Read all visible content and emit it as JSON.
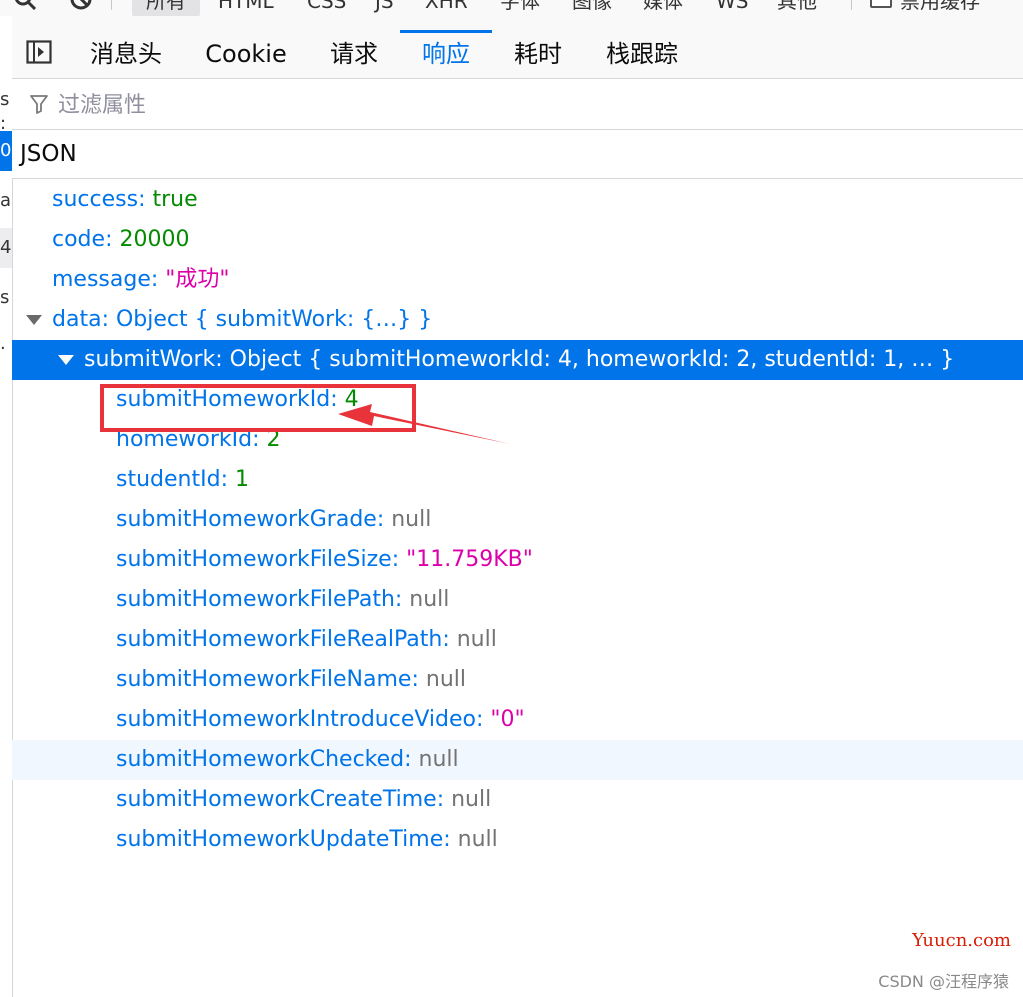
{
  "top_toolbar": {
    "filters": [
      "所有",
      "HTML",
      "CSS",
      "JS",
      "XHR",
      "字体",
      "图像",
      "媒体",
      "WS",
      "其他"
    ],
    "active_filter": "所有",
    "disable_cache_label": "禁用缓存"
  },
  "left_strip": [
    "s",
    ":",
    "0",
    "a",
    "4",
    "s",
    "."
  ],
  "tabs": [
    "消息头",
    "Cookie",
    "请求",
    "响应",
    "耗时",
    "栈跟踪"
  ],
  "active_tab": "响应",
  "filter": {
    "placeholder": "过滤属性"
  },
  "section_title": "JSON",
  "tree": {
    "success": {
      "key": "success",
      "value": "true"
    },
    "code": {
      "key": "code",
      "value": "20000"
    },
    "message": {
      "key": "message",
      "value": "\"成功\""
    },
    "data": {
      "key": "data",
      "value": "Object { submitWork: {…} }"
    },
    "submitWork": {
      "key": "submitWork",
      "value": "Object { submitHomeworkId: 4, homeworkId: 2, studentId: 1, … }"
    },
    "fields": [
      {
        "key": "submitHomeworkId",
        "value": "4",
        "type": "num"
      },
      {
        "key": "homeworkId",
        "value": "2",
        "type": "num"
      },
      {
        "key": "studentId",
        "value": "1",
        "type": "num"
      },
      {
        "key": "submitHomeworkGrade",
        "value": "null",
        "type": "null"
      },
      {
        "key": "submitHomeworkFileSize",
        "value": "\"11.759KB\"",
        "type": "str"
      },
      {
        "key": "submitHomeworkFilePath",
        "value": "null",
        "type": "null"
      },
      {
        "key": "submitHomeworkFileRealPath",
        "value": "null",
        "type": "null"
      },
      {
        "key": "submitHomeworkFileName",
        "value": "null",
        "type": "null"
      },
      {
        "key": "submitHomeworkIntroduceVideo",
        "value": "\"0\"",
        "type": "str"
      },
      {
        "key": "submitHomeworkChecked",
        "value": "null",
        "type": "null"
      },
      {
        "key": "submitHomeworkCreateTime",
        "value": "null",
        "type": "null"
      },
      {
        "key": "submitHomeworkUpdateTime",
        "value": "null",
        "type": "null"
      }
    ]
  },
  "watermark": {
    "site": "Yuucn.com",
    "author": "CSDN @汪程序猿"
  },
  "colors": {
    "accent": "#0074e8",
    "number": "#058b00",
    "string": "#dd00a9",
    "null": "#737373",
    "annotation": "#e8333a"
  }
}
